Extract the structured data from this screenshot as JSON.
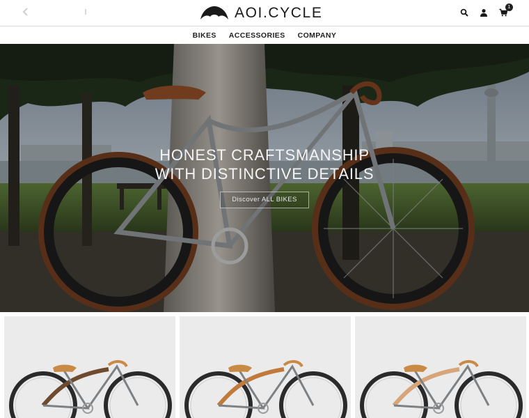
{
  "header": {
    "left_icons": [
      "arrow-left-icon",
      "info-icon"
    ],
    "logo_text": "AOI.CYCLE",
    "logo_icon": "umbrella-logo-icon",
    "actions": [
      {
        "icon": "search-icon"
      },
      {
        "icon": "user-icon"
      },
      {
        "icon": "cart-icon",
        "count": "1"
      }
    ]
  },
  "nav": {
    "items": [
      {
        "label": "BIKES"
      },
      {
        "label": "ACCESSORIES"
      },
      {
        "label": "COMPANY"
      }
    ]
  },
  "hero": {
    "title_line1": "HONEST CRAFTSMANSHIP",
    "title_line2": "WITH DISTINCTIVE DETAILS",
    "cta_label": "Discover ALL BIKES"
  },
  "products": [
    {
      "frame_color": "#6e4a2e",
      "accent": "#c98a45"
    },
    {
      "frame_color": "#c07a3c",
      "accent": "#c98a45"
    },
    {
      "frame_color": "#d6a57a",
      "accent": "#c98a45"
    }
  ],
  "colors": {
    "text": "#1f1f1f",
    "accent_leather": "#8a4a24",
    "background": "#ffffff",
    "product_bg": "#ebebeb"
  }
}
